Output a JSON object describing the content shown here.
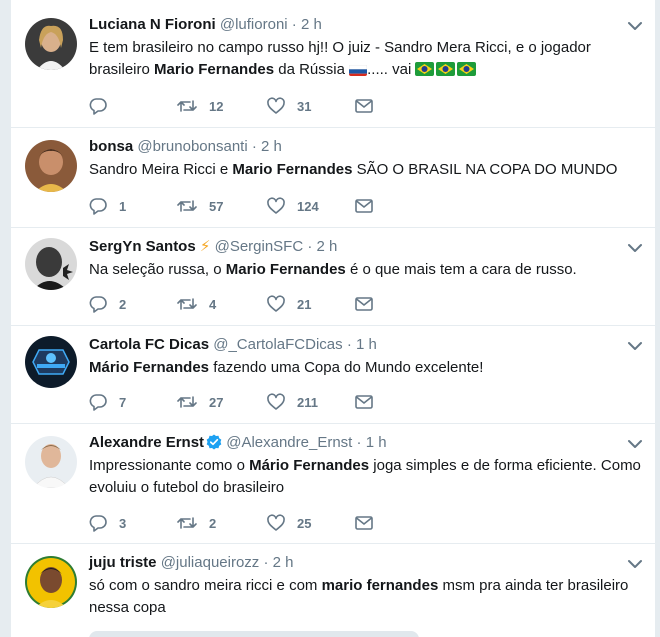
{
  "tweets": [
    {
      "fullname": "Luciana N Fioroni",
      "username": "@lufioroni",
      "time": "2 h",
      "text_parts": [
        "E tem brasileiro no campo russo hj!! O juiz - Sandro Mera Ricci, e o jogador brasileiro ",
        "Mario Fernandes",
        " da Rússia ",
        "..... vai "
      ],
      "emoji": [
        "flag-russia",
        "flag-brazil",
        "flag-brazil",
        "flag-brazil"
      ],
      "replies": "",
      "retweets": "12",
      "likes": "31"
    },
    {
      "fullname": "bonsa",
      "username": "@brunobonsanti",
      "time": "2 h",
      "text_parts": [
        "Sandro Meira Ricci e ",
        "Mario Fernandes",
        " SÃO O BRASIL NA COPA DO MUNDO"
      ],
      "replies": "1",
      "retweets": "57",
      "likes": "124"
    },
    {
      "fullname": "SergYn Santos",
      "fullname_emoji": "⚡",
      "username": "@SerginSFC",
      "time": "2 h",
      "text_parts": [
        "Na seleção russa, o ",
        "Mario Fernandes",
        " é o que mais tem a cara de russo."
      ],
      "replies": "2",
      "retweets": "4",
      "likes": "21"
    },
    {
      "fullname": "Cartola FC Dicas",
      "username": "@_CartolaFCDicas",
      "time": "1 h",
      "text_parts": [
        "Mário Fernandes",
        " fazendo uma Copa do Mundo excelente!"
      ],
      "replies": "7",
      "retweets": "27",
      "likes": "211"
    },
    {
      "fullname": "Alexandre Ernst",
      "username": "@Alexandre_Ernst",
      "time": "1 h",
      "verified": true,
      "text_parts": [
        "Impressionante como o ",
        "Mário Fernandes",
        " joga simples e de forma eficiente. Como evoluiu o futebol do brasileiro"
      ],
      "replies": "3",
      "retweets": "2",
      "likes": "25"
    },
    {
      "fullname": "juju triste",
      "username": "@juliaqueirozz",
      "time": "2 h",
      "text_parts": [
        "só com o sandro meira ricci e com ",
        "mario fernandes",
        " msm pra ainda ter brasileiro nessa copa"
      ]
    }
  ],
  "dot": "·",
  "colors": {
    "icon_gray": "#657786",
    "verified_blue": "#1da1f2",
    "border": "#e6ecf0",
    "background": "#e6ecf0"
  },
  "icons": [
    "reply-icon",
    "retweet-icon",
    "like-icon",
    "direct-message-icon",
    "chevron-down-icon",
    "verified-badge-icon",
    "lightning-emoji",
    "flag-russia",
    "flag-brazil"
  ]
}
